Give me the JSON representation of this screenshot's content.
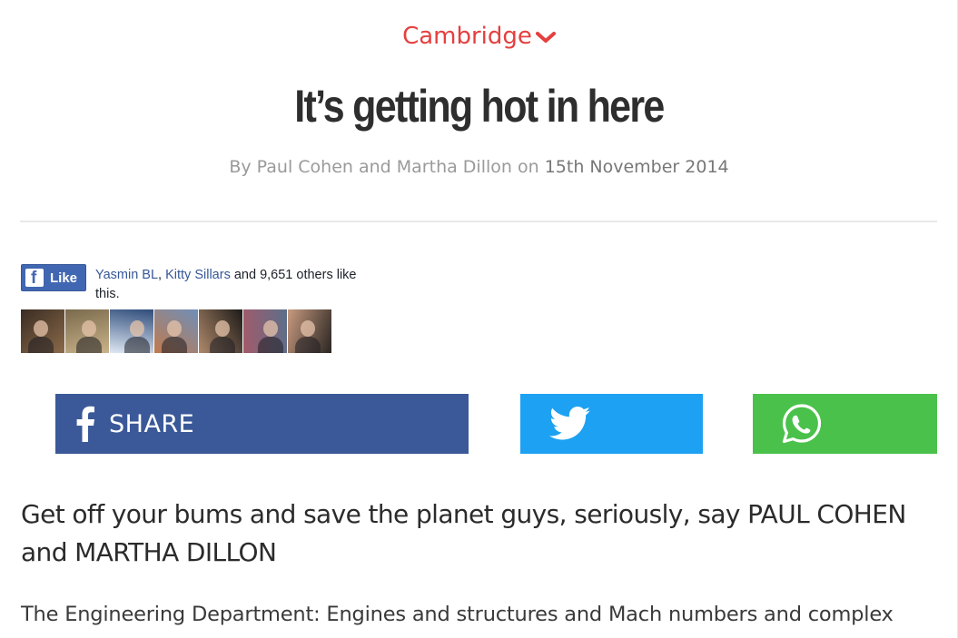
{
  "article": {
    "section": "Cambridge",
    "title": "It’s getting hot in here",
    "byline_prefix": "By Paul Cohen and Martha Dillon on ",
    "date": "15th November 2014",
    "standfirst": "Get off your bums and save the planet guys, seriously, say PAUL COHEN and MARTHA DILLON",
    "body_first_line": "The Engineering Department: Engines and structures and Mach numbers and complex"
  },
  "facebook_like": {
    "button_label": "Like",
    "friend1": "Yasmin BL",
    "separator": ", ",
    "friend2": "Kitty Sillars",
    "others": " and 9,651 others like this.",
    "friend_photos": [
      {
        "name": "friend-photo-1",
        "colors": [
          "#3a2c22",
          "#8a6a4a"
        ]
      },
      {
        "name": "friend-photo-2",
        "colors": [
          "#7a6a4c",
          "#c9b38a"
        ]
      },
      {
        "name": "friend-photo-3",
        "colors": [
          "#2e4c7a",
          "#dfe8f4"
        ]
      },
      {
        "name": "friend-photo-4",
        "colors": [
          "#6f8fb8",
          "#c07a4e"
        ]
      },
      {
        "name": "friend-photo-5",
        "colors": [
          "#1c1a18",
          "#b08a6c"
        ]
      },
      {
        "name": "friend-photo-6",
        "colors": [
          "#5b6f8a",
          "#a45a6a"
        ]
      },
      {
        "name": "friend-photo-7",
        "colors": [
          "#2a2622",
          "#c89a80"
        ]
      }
    ]
  },
  "share": {
    "facebook_label": "SHARE",
    "facebook_color": "#3b5998",
    "twitter_color": "#1da1f2",
    "whatsapp_color": "#4ac14b"
  },
  "colors": {
    "accent": "#e5403f"
  }
}
